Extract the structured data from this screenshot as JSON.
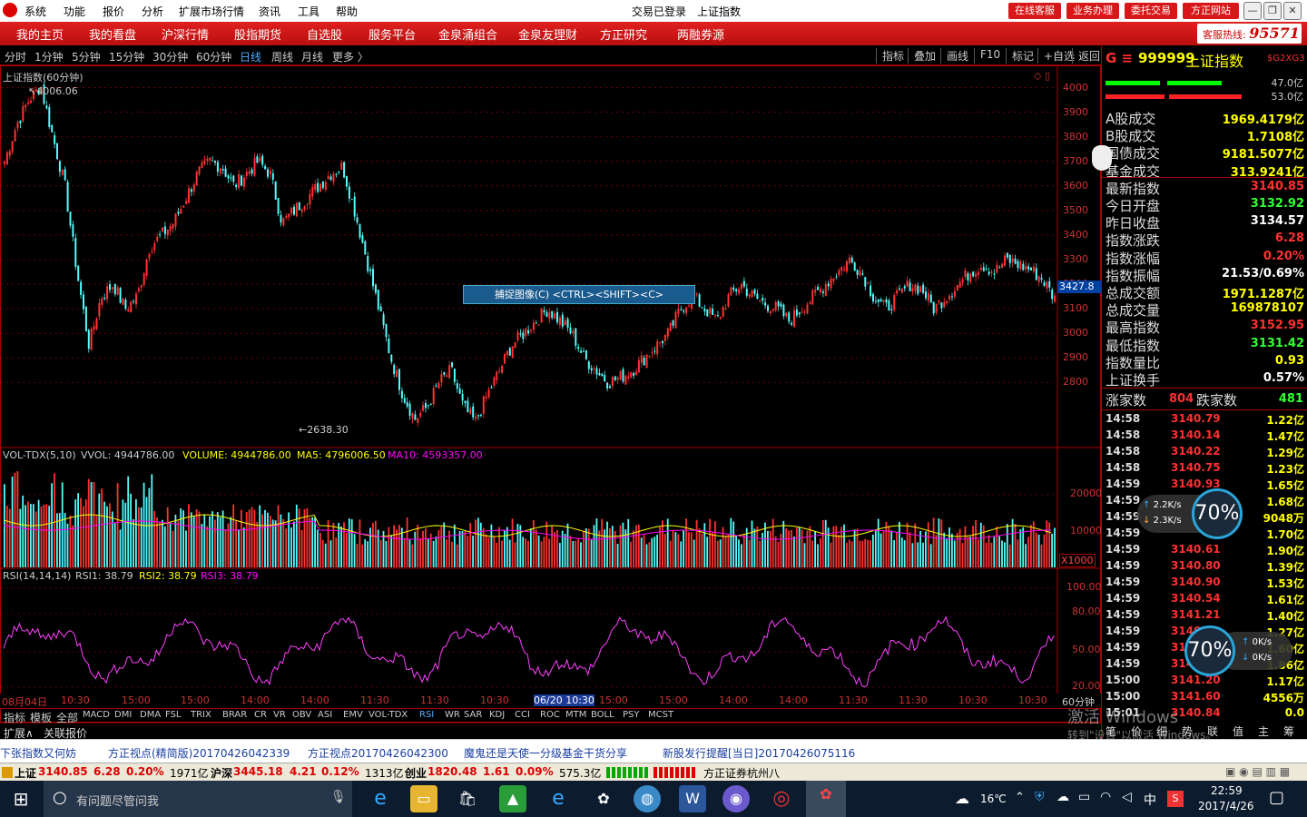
{
  "menu": {
    "items": [
      "系统",
      "功能",
      "报价",
      "分析",
      "扩展市场行情",
      "资讯",
      "工具",
      "帮助"
    ],
    "login_status": "交易已登录",
    "current_index": "上证指数",
    "right_buttons": [
      "在线客服",
      "业务办理",
      "委托交易",
      "方正网站"
    ]
  },
  "nav": {
    "items": [
      "我的主页",
      "我的看盘",
      "沪深行情",
      "股指期货",
      "自选股",
      "服务平台",
      "金泉涌组合",
      "金泉友理财",
      "方正研究",
      "两融券源"
    ],
    "hotline_label": "客服热线:",
    "hotline_number": "95571"
  },
  "period_bar": {
    "periods": [
      "分时",
      "1分钟",
      "5分钟",
      "15分钟",
      "30分钟",
      "60分钟",
      "日线",
      "周线",
      "月线",
      "更多 〉"
    ],
    "active": "日线",
    "tools": [
      "指标",
      "叠加",
      "画线",
      "F10",
      "标记",
      "+自选",
      "返回"
    ]
  },
  "chart_data": {
    "type": "candlestick",
    "title": "上证指数(60分钟)",
    "y_ticks": [
      4000,
      3900,
      3800,
      3700,
      3600,
      3500,
      3400,
      3300,
      3200,
      3100,
      3000,
      2900,
      2800
    ],
    "y_range": [
      2638.3,
      4006.06
    ],
    "high_label": "4006.06",
    "low_label": "2638.30",
    "cursor_value": "3427.8",
    "close_path": [
      3700,
      3850,
      3950,
      4006,
      3800,
      3600,
      3250,
      2950,
      3150,
      3200,
      3100,
      3150,
      3350,
      3400,
      3450,
      3550,
      3650,
      3700,
      3680,
      3600,
      3650,
      3700,
      3650,
      3450,
      3500,
      3550,
      3600,
      3650,
      3680,
      3500,
      3300,
      3100,
      2900,
      2750,
      2650,
      2700,
      2800,
      2850,
      2700,
      2638,
      2750,
      2850,
      2950,
      3000,
      3050,
      3100,
      3050,
      3000,
      2900,
      2850,
      2800,
      2820,
      2850,
      2900,
      2950,
      3000,
      3100,
      3150,
      3100,
      3050,
      3150,
      3200,
      3150,
      3120,
      3100,
      3050,
      3100,
      3150,
      3200,
      3250,
      3300,
      3250,
      3150,
      3100,
      3150,
      3200,
      3180,
      3100,
      3150,
      3200,
      3250,
      3280,
      3250,
      3300,
      3280,
      3260,
      3220,
      3140
    ],
    "volume_panel": {
      "title": "VOL-TDX(5,10)",
      "vvol": "VVOL: 4944786.00",
      "volume": "VOLUME: 4944786.00",
      "ma5": "MA5: 4796006.50",
      "ma10": "MA10: 4593357.00",
      "y_ticks": [
        "20000",
        "10000"
      ],
      "unit": "X1000"
    },
    "rsi_panel": {
      "title": "RSI(14,14,14)",
      "rsi1": "RSI1: 38.79",
      "rsi2": "RSI2: 38.79",
      "rsi3": "RSI3: 38.79",
      "y_ticks": [
        "100.00",
        "80.00",
        "50.00",
        "20.00"
      ]
    },
    "time_labels": [
      "08月04日",
      "10:30",
      "15:00",
      "15:00",
      "14:00",
      "14:00",
      "11:30",
      "11:30",
      "10:30",
      "06/20 10:30",
      "15:00",
      "15:00",
      "14:00",
      "14:00",
      "11:30",
      "11:30",
      "10:30",
      "10:30"
    ],
    "period_label": "60分钟"
  },
  "capture_tip": "捕捉图像(C)   <CTRL><SHIFT><C>",
  "indicator_tabs": [
    "指标",
    "模板",
    "全部",
    "MACD",
    "DMI",
    "DMA",
    "FSL",
    "TRIX",
    "BRAR",
    "CR",
    "VR",
    "OBV",
    "ASI",
    "EMV",
    "VOL-TDX",
    "RSI",
    "WR",
    "SAR",
    "KDJ",
    "CCI",
    "ROC",
    "MTM",
    "BOLL",
    "PSY",
    "MCST"
  ],
  "active_indicator": "RSI",
  "bottom_tabs": [
    "扩展∧",
    "关联报价"
  ],
  "side": {
    "code": "999999",
    "name": "上证指数",
    "tag": "$G2XG3",
    "up_amount": "47.0亿",
    "down_amount": "53.0亿",
    "quotes": [
      {
        "label": "A股成交",
        "value": "1969.4179亿",
        "color": "#ff0"
      },
      {
        "label": "B股成交",
        "value": "1.7108亿",
        "color": "#ff0"
      },
      {
        "label": "国债成交",
        "value": "9181.5077亿",
        "color": "#ff0"
      },
      {
        "label": "基金成交",
        "value": "313.9241亿",
        "color": "#ff0"
      },
      {
        "label": "最新指数",
        "value": "3140.85",
        "color": "#ff3030"
      },
      {
        "label": "今日开盘",
        "value": "3132.92",
        "color": "#3f3"
      },
      {
        "label": "昨日收盘",
        "value": "3134.57",
        "color": "#fff"
      },
      {
        "label": "指数涨跌",
        "value": "6.28",
        "color": "#ff3030"
      },
      {
        "label": "指数涨幅",
        "value": "0.20%",
        "color": "#ff3030"
      },
      {
        "label": "指数振幅",
        "value": "21.53/0.69%",
        "color": "#fff"
      },
      {
        "label": "总成交额",
        "value": "1971.1287亿",
        "color": "#ff0"
      },
      {
        "label": "总成交量",
        "value": "169878107",
        "color": "#ff0"
      },
      {
        "label": "最高指数",
        "value": "3152.95",
        "color": "#ff3030"
      },
      {
        "label": "最低指数",
        "value": "3131.42",
        "color": "#3f3"
      },
      {
        "label": "指数量比",
        "value": "0.93",
        "color": "#ff0"
      },
      {
        "label": "上证换手",
        "value": "0.57%",
        "color": "#fff"
      }
    ],
    "up_count_label": "涨家数",
    "up_count": "804",
    "down_count_label": "跌家数",
    "down_count": "481",
    "ticks": [
      {
        "t": "14:58",
        "p": "3140.79",
        "v": "1.22亿"
      },
      {
        "t": "14:58",
        "p": "3140.14",
        "v": "1.47亿"
      },
      {
        "t": "14:58",
        "p": "3140.22",
        "v": "1.29亿"
      },
      {
        "t": "14:58",
        "p": "3140.75",
        "v": "1.23亿"
      },
      {
        "t": "14:59",
        "p": "3140.93",
        "v": "1.65亿"
      },
      {
        "t": "14:59",
        "p": "",
        "v": "1.68亿"
      },
      {
        "t": "14:59",
        "p": "",
        "v": "9048万"
      },
      {
        "t": "14:59",
        "p": "",
        "v": "1.70亿"
      },
      {
        "t": "14:59",
        "p": "3140.61",
        "v": "1.90亿"
      },
      {
        "t": "14:59",
        "p": "3140.80",
        "v": "1.39亿"
      },
      {
        "t": "14:59",
        "p": "3140.90",
        "v": "1.53亿"
      },
      {
        "t": "14:59",
        "p": "3140.54",
        "v": "1.61亿"
      },
      {
        "t": "14:59",
        "p": "3141.21",
        "v": "1.40亿"
      },
      {
        "t": "14:59",
        "p": "3140.70",
        "v": "1.27亿"
      },
      {
        "t": "14:59",
        "p": "31",
        "v": "1.60亿"
      },
      {
        "t": "14:59",
        "p": "3140.80",
        "v": "1.86亿"
      },
      {
        "t": "15:00",
        "p": "3141.20",
        "v": "1.17亿"
      },
      {
        "t": "15:00",
        "p": "3141.60",
        "v": "4556万"
      },
      {
        "t": "15:01",
        "p": "3140.84",
        "v": "0.0"
      }
    ],
    "bottom_tabs": [
      "笔",
      "价",
      "细",
      "势",
      "联",
      "值",
      "主",
      "筹"
    ]
  },
  "gauge1": {
    "up": "2.2K/s",
    "down": "2.3K/s",
    "pct": "70%"
  },
  "gauge2": {
    "up": "0K/s",
    "down": "0K/s",
    "pct": "70%"
  },
  "watermark": {
    "line1": "激活 Windows",
    "line2": "转到\"设置\"以激活 Windows。"
  },
  "news": [
    "下张指数又何妨",
    "方正视点(精简版)20170426042339",
    "方正视点20170426042300",
    "魔鬼还是天使一分级基金干货分享",
    "新股发行提醒[当日]20170426075116"
  ],
  "status": {
    "sh_label": "上证",
    "sh_value": "3140.85",
    "sh_change": "6.28",
    "sh_pct": "0.20%",
    "sh_amount": "1971亿",
    "sz_label": "沪深",
    "sz_value": "3445.18",
    "sz_change": "4.21",
    "sz_pct": "0.12%",
    "sz_amount": "1313亿",
    "cy_label": "创业",
    "cy_value": "1820.48",
    "cy_change": "1.61",
    "cy_pct": "0.09%",
    "cy_amount": "575.3亿",
    "broker": "方正证券杭州八"
  },
  "taskbar": {
    "search_placeholder": "有问题尽管问我",
    "weather": "16℃",
    "ime": "中",
    "time": "22:59",
    "date": "2017/4/26"
  }
}
